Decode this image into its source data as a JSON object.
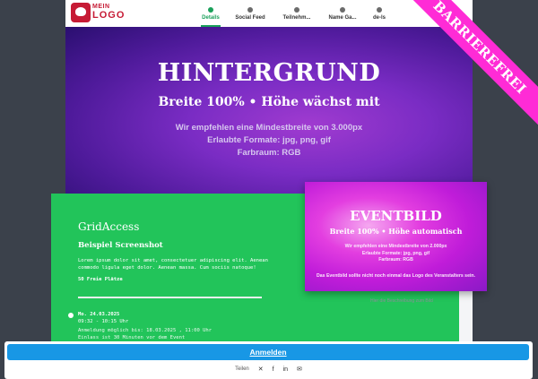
{
  "logo": {
    "line1": "MEIN",
    "line2": "LOGO"
  },
  "nav": {
    "tabs": [
      {
        "label": "Details",
        "active": true
      },
      {
        "label": "Social Feed",
        "active": false
      },
      {
        "label": "Teilnehm...",
        "active": false
      },
      {
        "label": "Name Ga...",
        "active": false
      },
      {
        "label": "de-ls",
        "active": false
      }
    ]
  },
  "ribbon": {
    "label": "BARRIEREFREI",
    "color": "#ff2bd6"
  },
  "hero": {
    "title": "HINTERGRUND",
    "subtitle": "Breite 100% • Höhe wächst mit",
    "info_lines": [
      "Wir empfehlen eine Mindestbreite von 3.000px",
      "Erlaubte Formate: jpg, png, gif",
      "Farbraum: RGB"
    ]
  },
  "event": {
    "title": "GridAccess",
    "subtitle": "Beispiel Screenshot",
    "description": "Lorem ipsum dolor sit amet, consectetuer adipiscing elit. Aenean commodo ligula eget dolor. Aenean massa. Cum sociis natoque!",
    "seats": "50 Freie Plätze",
    "date": "Mo.  24.03.2025",
    "time": "09:32 - 10:15  Uhr",
    "registration": "Anmeldung möglich bis:  18.03.2025 , 11:00  Uhr",
    "admission": "Einlass ist 30 Minuten vor dem Event",
    "card_color": "#22c45a"
  },
  "event_image": {
    "title": "EVENTBILD",
    "subtitle": "Breite 100% • Höhe automatisch",
    "info_lines": [
      "Wir empfehlen eine Mindestbreite von 2.000px",
      "Erlaubte Formate: jpg, png, gif",
      "Farbraum: RGB"
    ],
    "note": "Das Eventbild sollte nicht noch einmal das Logo des Veranstalters sein.",
    "caption": "Hier die Beschreibung zum Bild"
  },
  "footer": {
    "signup_label": "Anmelden",
    "share_label": "Teilen",
    "share_icons": [
      "x-icon",
      "facebook-icon",
      "linkedin-icon",
      "mail-icon"
    ],
    "accent": "#1897e5"
  }
}
